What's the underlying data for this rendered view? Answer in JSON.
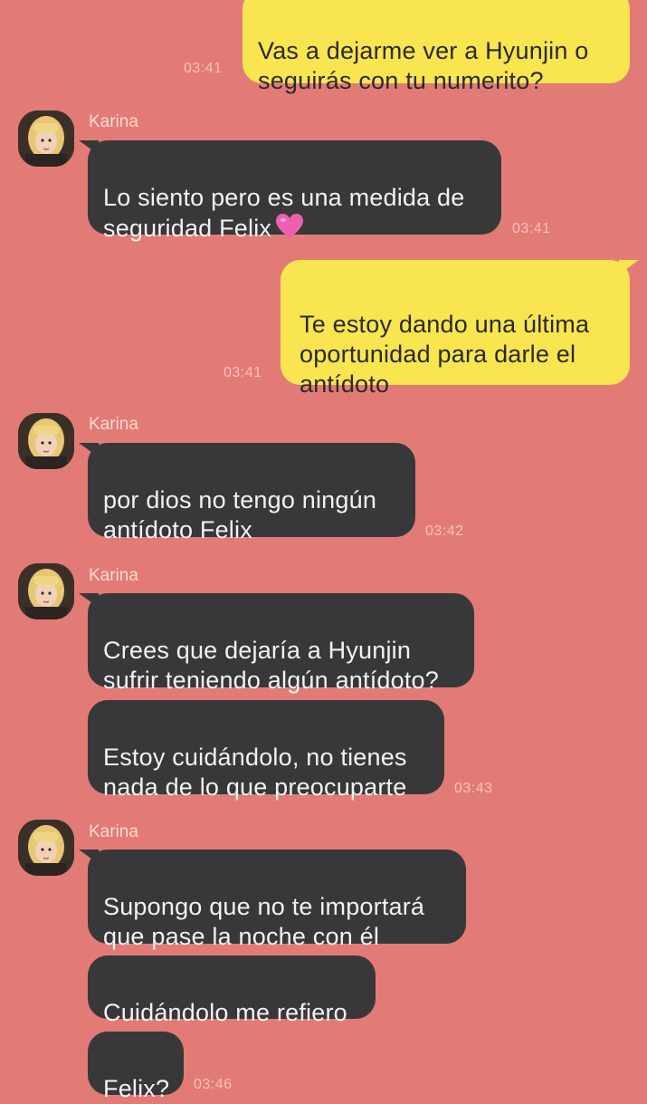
{
  "messages": {
    "m1": {
      "text": "Vas a dejarme ver a Hyunjin o\nseguirás con tu numerito?",
      "time": "03:41"
    },
    "g1": {
      "sender": "Karina",
      "m2": {
        "text": "Lo siento pero es una medida de\nseguridad Felix",
        "emoji": "pink-heart",
        "time": "03:41"
      }
    },
    "m3": {
      "text": "Te estoy dando una última\noportunidad para darle el\nantídoto",
      "time": "03:41"
    },
    "g2": {
      "sender": "Karina",
      "m4": {
        "text": "por dios no tengo ningún\nantídoto Felix",
        "time": "03:42"
      }
    },
    "g3": {
      "sender": "Karina",
      "m5": {
        "text": "Crees que dejaría a Hyunjin\nsufrir teniendo algún antídoto?"
      },
      "m6": {
        "text": "Estoy cuidándolo, no tienes\nnada de lo que preocuparte",
        "time": "03:43"
      }
    },
    "g4": {
      "sender": "Karina",
      "m7": {
        "text": "Supongo que no te importará\nque pase la noche con él"
      },
      "m8": {
        "text": "Cuidándolo me refiero"
      },
      "m9": {
        "text": "Felix?",
        "time": "03:46"
      }
    }
  },
  "colors": {
    "background": "#e27b76",
    "mine_bubble": "#f8e550",
    "theirs_bubble": "#38383b"
  }
}
